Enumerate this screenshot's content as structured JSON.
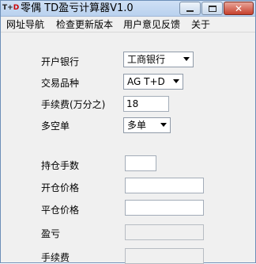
{
  "window": {
    "title": "零偶 TD盈亏计算器V1.0",
    "icon_text_t": "T",
    "icon_text_plus": "+",
    "icon_text_d": "D",
    "close_glyph": "✕"
  },
  "menu": [
    "网址导航",
    "检查更新版本",
    "用户意见反馈",
    "关于"
  ],
  "form": {
    "bank_label": "开户银行",
    "bank_value": "工商银行",
    "product_label": "交易品种",
    "product_value": "AG T+D",
    "fee_rate_label": "手续费(万分之)",
    "fee_rate_value": "18",
    "direction_label": "多空单",
    "direction_value": "多单",
    "lots_label": "持仓手数",
    "lots_value": "",
    "open_price_label": "开仓价格",
    "open_price_value": "",
    "close_price_label": "平仓价格",
    "close_price_value": "",
    "pnl_label": "盈亏",
    "pnl_value": "",
    "fee_label": "手续费",
    "fee_value": ""
  },
  "colors": {
    "title_bar": "#c3d7f0",
    "close_button": "#c7402d",
    "window_bg": "#f0f0f0"
  },
  "icons": [
    "app-icon",
    "minimize-icon",
    "maximize-icon",
    "close-icon",
    "dropdown-arrow-icon"
  ]
}
